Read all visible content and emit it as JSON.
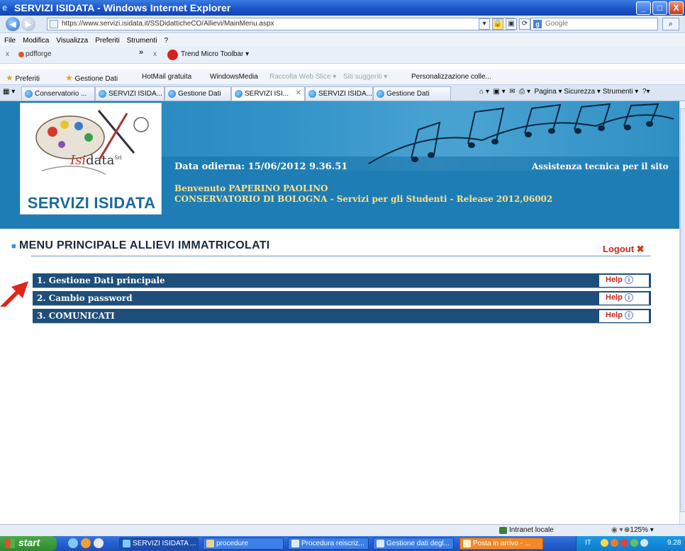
{
  "window": {
    "title": "SERVIZI ISIDATA - Windows Internet Explorer",
    "btn_min": "_",
    "btn_max": "□",
    "btn_close": "X"
  },
  "address": {
    "url": "https://www.servizi.isidata.it/SSDidatticheCO/Allievi/MainMenu.aspx",
    "search_placeholder": "Google"
  },
  "menubar": [
    "File",
    "Modifica",
    "Visualizza",
    "Preferiti",
    "Strumenti",
    "?"
  ],
  "toolbar": {
    "pdfforge": "pdfforge",
    "trend": "Trend Micro Toolbar ▾"
  },
  "favorites": {
    "label": "Preferiti",
    "items": [
      {
        "label": "Gestione Dati"
      },
      {
        "label": "HotMail gratuita"
      },
      {
        "label": "WindowsMedia"
      },
      {
        "label": "Raccolta Web Slice ▾"
      },
      {
        "label": "Siti suggeriti ▾"
      },
      {
        "label": "Personalizzazione colle..."
      }
    ]
  },
  "tabs": [
    {
      "label": "Conservatorio ..."
    },
    {
      "label": "SERVIZI ISIDA..."
    },
    {
      "label": "Gestione Dati"
    },
    {
      "label": "SERVIZI ISI..."
    },
    {
      "label": "SERVIZI ISIDA..."
    },
    {
      "label": "Gestione Dati"
    }
  ],
  "commandbar": "Pagina ▾   Sicurezza ▾   Strumenti ▾",
  "page": {
    "brand": {
      "isi": "Isi",
      "data": "data",
      "srl": "Srl"
    },
    "logo_name": "SERVIZI ISIDATA",
    "date_line": "Data odierna: 15/06/2012 9.36.51",
    "assist": "Assistenza tecnica per il sito",
    "welcome": "Benvenuto PAPERINO PAOLINO",
    "conservatorio": "CONSERVATORIO DI BOLOGNA - Servizi per gli Studenti - Release 2012,06002",
    "menu_title": "MENU PRINCIPALE ALLIEVI IMMATRICOLATI",
    "logout": "Logout",
    "help_label": "Help",
    "menu_items": [
      {
        "label": "1. Gestione Dati principale"
      },
      {
        "label": "2. Cambio password"
      },
      {
        "label": "3. COMUNICATI"
      }
    ]
  },
  "status": {
    "zone": "Intranet locale",
    "zoom": "125%"
  },
  "taskbar": {
    "start": "start",
    "tasks": [
      {
        "label": "SERVIZI ISIDATA ..."
      },
      {
        "label": "procedure"
      },
      {
        "label": "Procedura reiscriz..."
      },
      {
        "label": "Gestione dati degl..."
      },
      {
        "label": "Posta in arrivo - ..."
      }
    ],
    "lang": "IT",
    "clock": "9.28"
  }
}
